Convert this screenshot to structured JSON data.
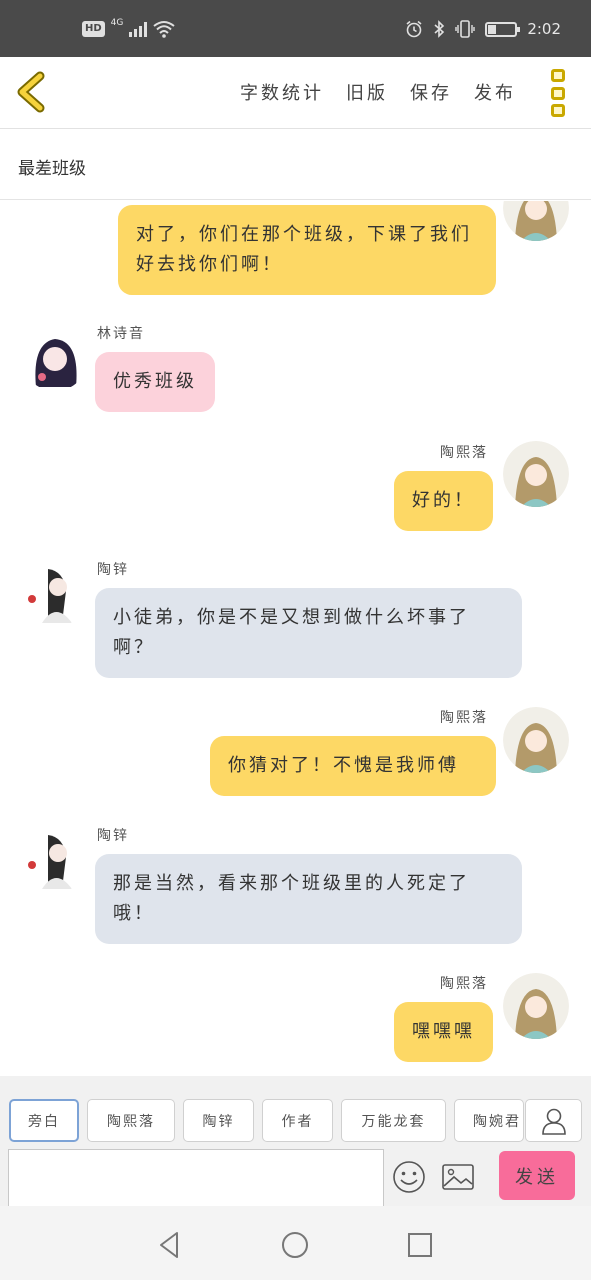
{
  "status_bar": {
    "hd": "HD",
    "network": "4G",
    "battery_level": 0.3,
    "time": "2:02"
  },
  "toolbar": {
    "actions": [
      "字数统计",
      "旧版",
      "保存",
      "发布"
    ]
  },
  "story": {
    "title": "最差班级"
  },
  "messages": [
    {
      "speaker": "",
      "text": "对了，你们在那个班级，下课了我们好去找你们啊！",
      "side": "right",
      "color": "yellow"
    },
    {
      "speaker": "林诗音",
      "text": "优秀班级",
      "side": "left",
      "color": "pink"
    },
    {
      "speaker": "陶熙落",
      "text": "好的！",
      "side": "right",
      "color": "yellow"
    },
    {
      "speaker": "陶锌",
      "text": "小徒弟，你是不是又想到做什么坏事了啊？",
      "side": "left",
      "color": "gray"
    },
    {
      "speaker": "陶熙落",
      "text": "你猜对了！不愧是我师傅",
      "side": "right",
      "color": "yellow"
    },
    {
      "speaker": "陶锌",
      "text": "那是当然，看来那个班级里的人死定了哦！",
      "side": "left",
      "color": "gray"
    },
    {
      "speaker": "陶熙落",
      "text": "嘿嘿嘿",
      "side": "right",
      "color": "yellow"
    }
  ],
  "roles": [
    "旁白",
    "陶熙落",
    "陶锌",
    "作者",
    "万能龙套",
    "陶婉君"
  ],
  "input": {
    "value": "",
    "placeholder": ""
  },
  "send_label": "发送",
  "icons": {
    "back": "chevron-left-icon",
    "more": "more-vertical-icon",
    "person": "person-icon",
    "emoji": "smiley-icon",
    "image": "image-icon"
  },
  "colors": {
    "accent_yellow": "#fdd865",
    "pink_bubble": "#fcd2db",
    "gray_bubble": "#dfe4ec",
    "send_button": "#f86c9a",
    "menu_icon": "#c9a800"
  }
}
